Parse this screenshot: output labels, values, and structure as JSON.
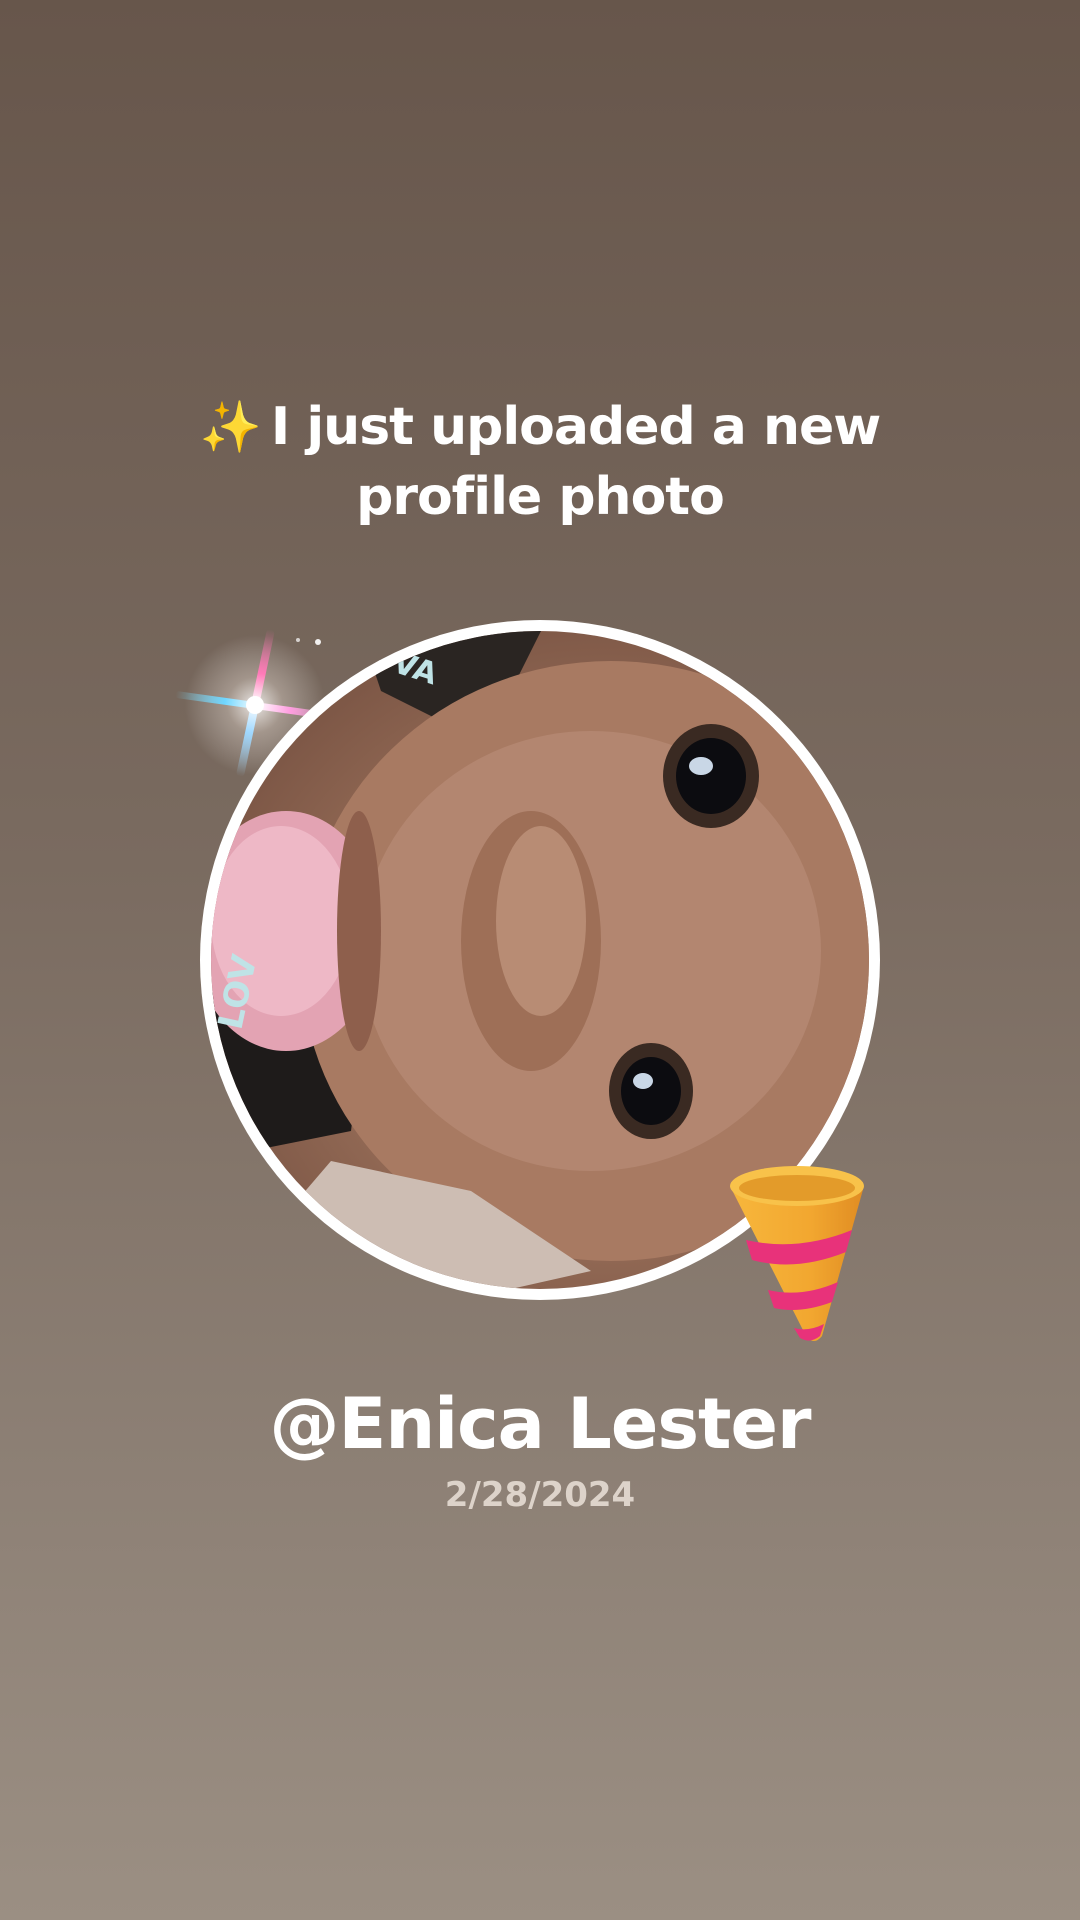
{
  "story": {
    "headline_icon": "sparkles-icon",
    "headline_emoji": "✨",
    "headline_text": "I just uploaded a new profile photo",
    "username": "@Enica Lester",
    "date": "2/28/2024"
  },
  "decorations": {
    "flare_icon": "lens-flare-sparkle-icon",
    "popper_icon": "party-popper-icon"
  },
  "colors": {
    "background_top": "#67564b",
    "background_bottom": "#9b8f83",
    "text": "#ffffff",
    "date_text": "#ddd3ca",
    "frame": "#ffffff",
    "popper_gold": "#f2a730",
    "popper_stripe": "#e8327a"
  }
}
